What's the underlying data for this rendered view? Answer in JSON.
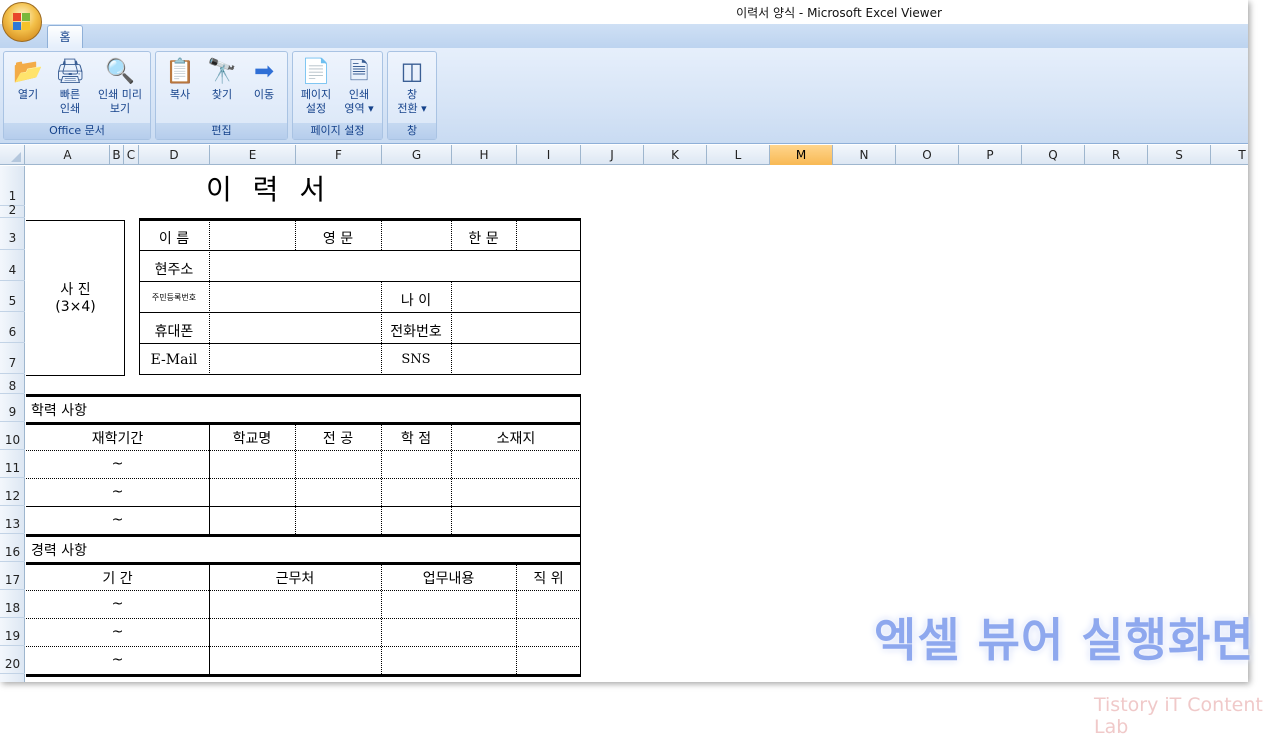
{
  "window": {
    "title": "이력서 양식 - Microsoft Excel Viewer"
  },
  "tabs": [
    {
      "label": "홈"
    }
  ],
  "ribbon": {
    "groups": [
      {
        "label": "Office 문서",
        "buttons": [
          {
            "line1": "열기",
            "line2": ""
          },
          {
            "line1": "빠른",
            "line2": "인쇄"
          },
          {
            "line1": "인쇄 미리",
            "line2": "보기"
          }
        ]
      },
      {
        "label": "편집",
        "buttons": [
          {
            "line1": "복사",
            "line2": ""
          },
          {
            "line1": "찾기",
            "line2": ""
          },
          {
            "line1": "이동",
            "line2": ""
          }
        ]
      },
      {
        "label": "페이지 설정",
        "buttons": [
          {
            "line1": "페이지",
            "line2": "설정"
          },
          {
            "line1": "인쇄",
            "line2": "영역 ▾"
          }
        ]
      },
      {
        "label": "창",
        "buttons": [
          {
            "line1": "창",
            "line2": "전환 ▾"
          }
        ]
      }
    ]
  },
  "columns": [
    "A",
    "B",
    "C",
    "D",
    "E",
    "F",
    "G",
    "H",
    "I",
    "J",
    "K",
    "L",
    "M",
    "N",
    "O",
    "P",
    "Q",
    "R",
    "S",
    "T"
  ],
  "active_column": "M",
  "rows": [
    "1",
    "2",
    "3",
    "4",
    "5",
    "6",
    "7",
    "8",
    "9",
    "10",
    "11",
    "12",
    "13",
    "16",
    "17",
    "18",
    "19",
    "20"
  ],
  "sheet": {
    "title": "이 력 서",
    "photo": {
      "line1": "사 진",
      "line2": "(3×4)"
    },
    "info": {
      "name": "이 름",
      "english": "영 문",
      "hanja": "한 문",
      "address": "현주소",
      "resident_no": "주민등록번호",
      "age": "나 이",
      "mobile": "휴대폰",
      "phone": "전화번호",
      "email": "E-Mail",
      "sns": "SNS"
    },
    "education": {
      "heading": "학력 사항",
      "headers": [
        "재학기간",
        "학교명",
        "전 공",
        "학 점",
        "소재지"
      ],
      "rows": [
        "~",
        "~",
        "~"
      ]
    },
    "career": {
      "heading": "경력 사항",
      "headers": [
        "기 간",
        "근무처",
        "업무내용",
        "직 위"
      ],
      "rows": [
        "~",
        "~",
        "~"
      ]
    }
  },
  "overlay": {
    "watermark": "엑셀 뷰어 실행화면",
    "credit": "Tistory iT Content Lab"
  }
}
